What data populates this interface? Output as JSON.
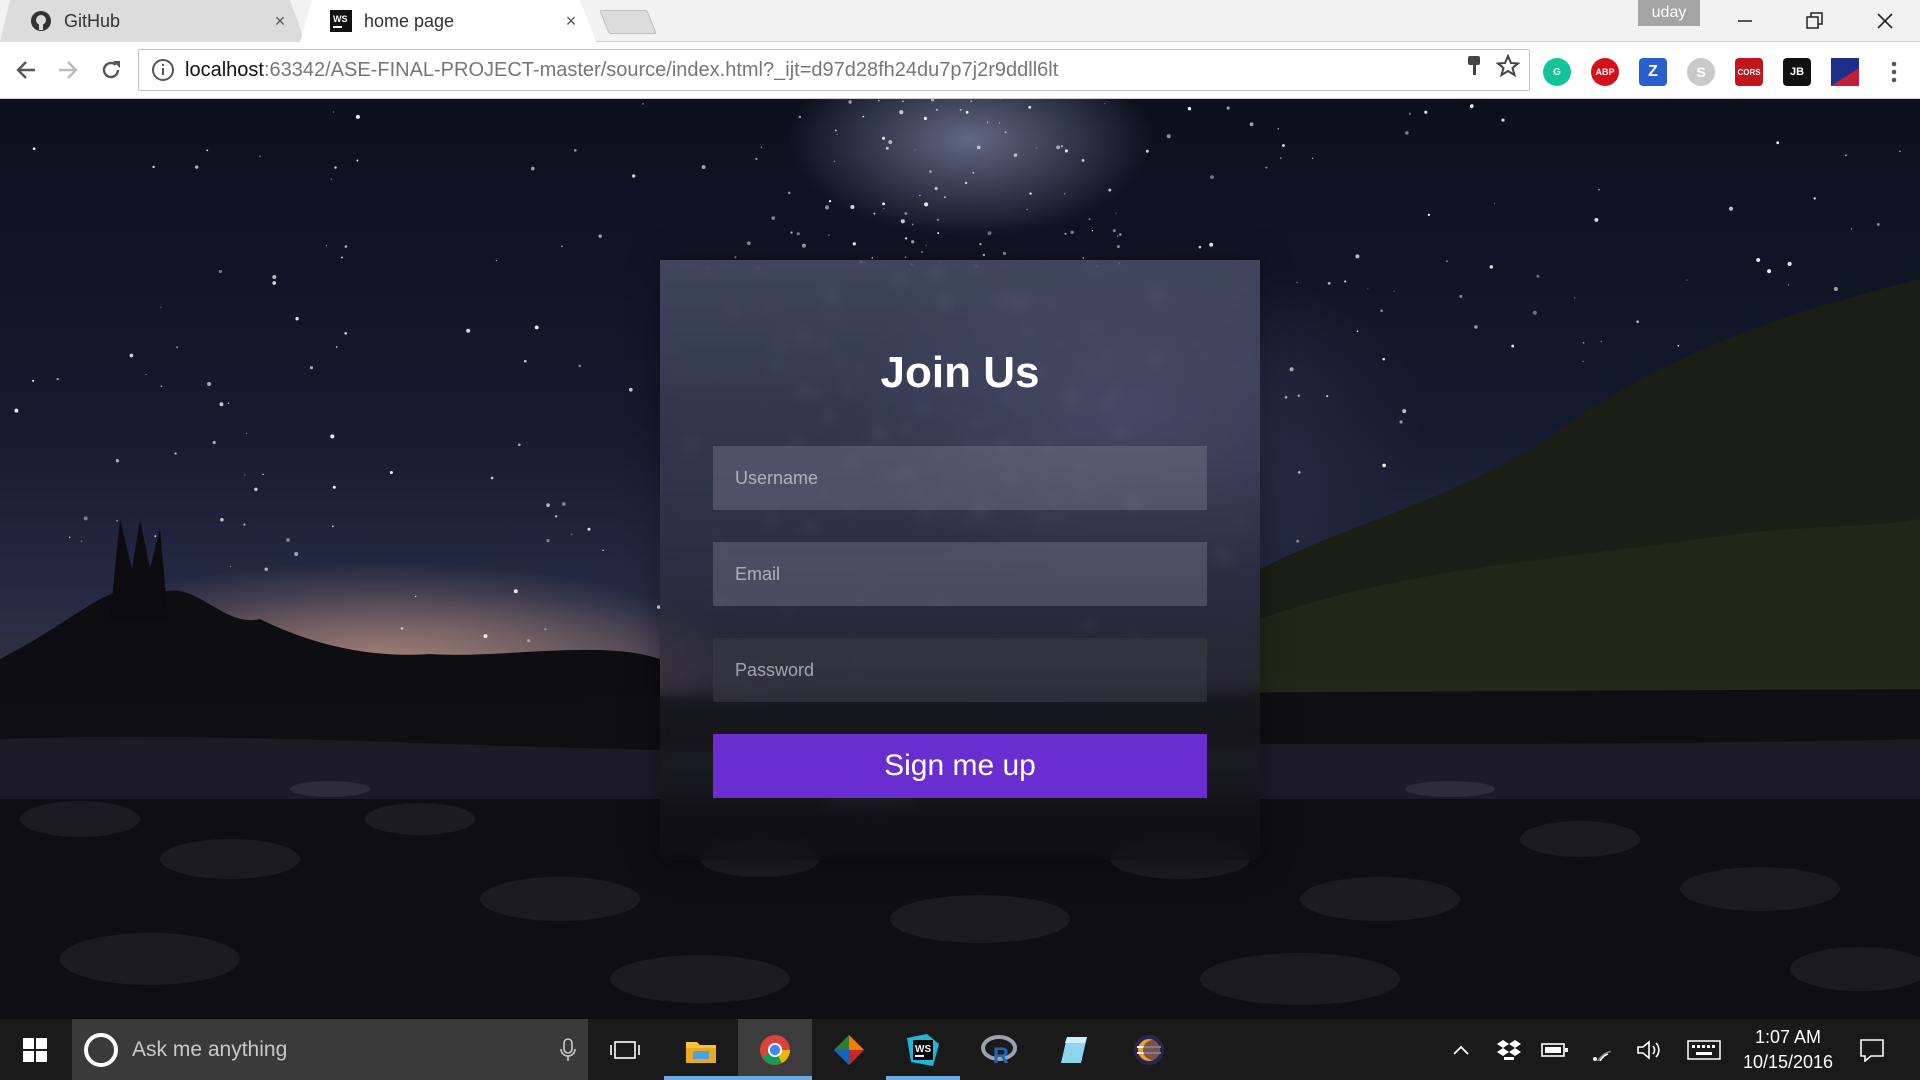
{
  "browser": {
    "tabs": [
      {
        "label": "GitHub",
        "close": "×"
      },
      {
        "label": "home page",
        "close": "×"
      }
    ],
    "profile_name": "uday",
    "url_host": "localhost",
    "url_rest": ":63342/ASE-FINAL-PROJECT-master/source/index.html?_ijt=d97d28fh24du7p7j2r9ddll6lt",
    "extensions": [
      "G",
      "ABP",
      "Z",
      "S",
      "CORS",
      "JB",
      "flag"
    ]
  },
  "form": {
    "title": "Join Us",
    "username_placeholder": "Username",
    "email_placeholder": "Email",
    "password_placeholder": "Password",
    "submit_label": "Sign me up",
    "accent": "#6a2ed0"
  },
  "taskbar": {
    "search_placeholder": "Ask me anything",
    "time": "1:07 AM",
    "date": "10/15/2016"
  }
}
